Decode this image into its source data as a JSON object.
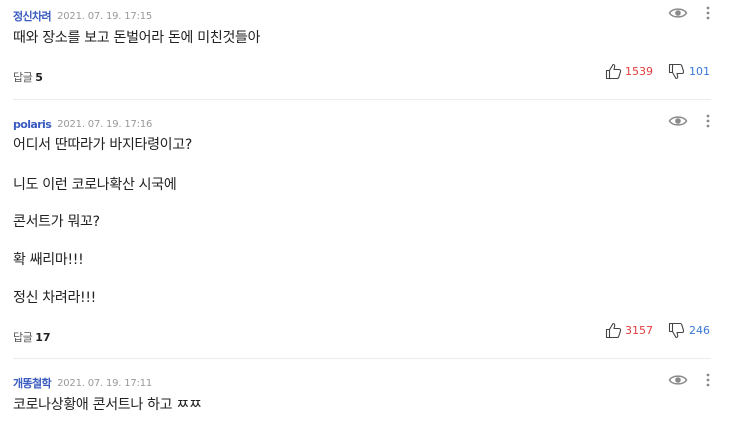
{
  "comments": [
    {
      "author": "정신차려",
      "date": "2021. 07. 19. 17:15",
      "lines": [
        "때와 장소를 보고 돈벌어라 돈에 미친것들아"
      ],
      "reply_label": "답글",
      "reply_count": "5",
      "likes": "1539",
      "dislikes": "101"
    },
    {
      "author": "polaris",
      "date": "2021. 07. 19. 17:16",
      "lines": [
        "어디서 딴따라가 바지타령이고?",
        "니도 이런 코로나확산 시국에",
        "콘서트가 뭐꼬?",
        "확 쌔리마!!!",
        "정신 차려라!!!"
      ],
      "reply_label": "답글",
      "reply_count": "17",
      "likes": "3157",
      "dislikes": "246"
    },
    {
      "author": "개똥철학",
      "date": "2021. 07. 19. 17:11",
      "lines": [
        "코로나상황애 콘서트나 하고 ㅉㅉ"
      ]
    }
  ],
  "icons": {
    "view": "eye-icon",
    "more": "more-vertical-icon",
    "like": "thumbs-up-icon",
    "dislike": "thumbs-down-icon"
  },
  "colors": {
    "author": "#3a5bbf",
    "like_count": "#e33c3c",
    "dislike_count": "#3a78d8",
    "date": "#999999",
    "divider": "#ececec"
  }
}
